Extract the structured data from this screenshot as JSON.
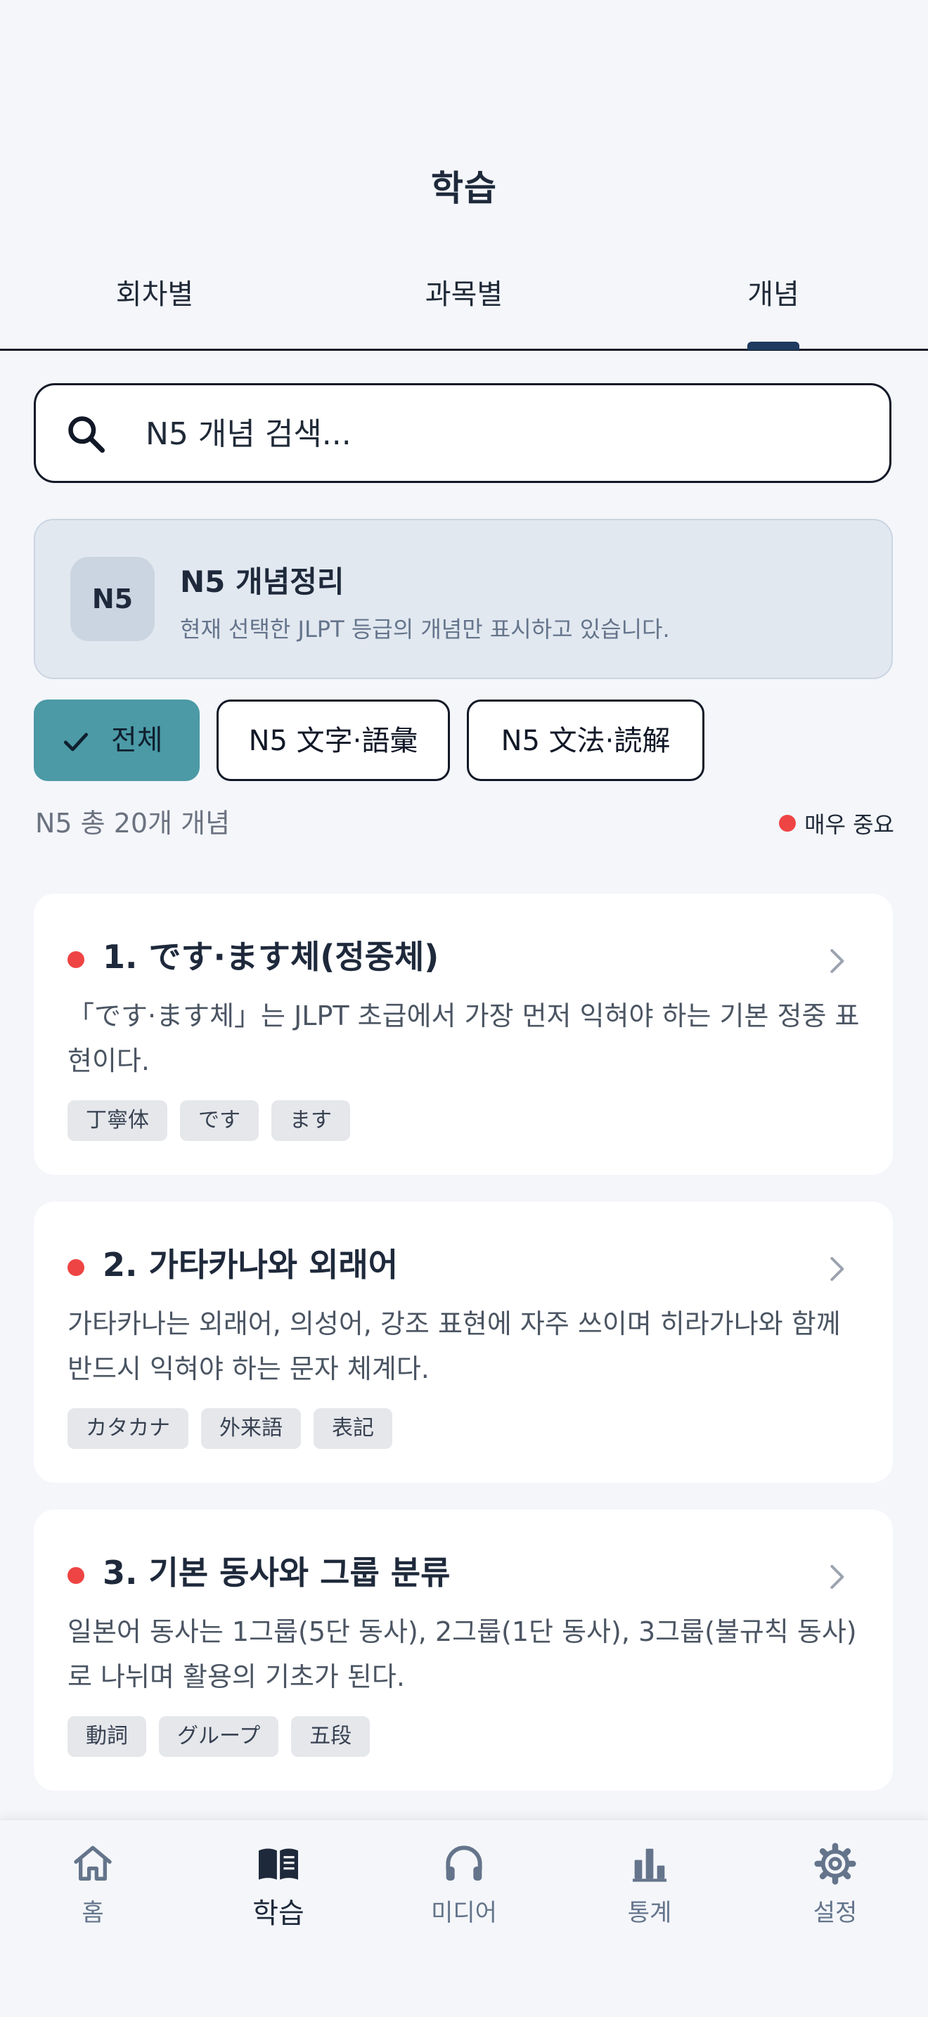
{
  "header": {
    "title": "학습",
    "tabs": [
      {
        "label": "회차별"
      },
      {
        "label": "과목별"
      },
      {
        "label": "개념"
      }
    ],
    "active_tab": "개념"
  },
  "search": {
    "placeholder": "N5 개념 검색..."
  },
  "info_card": {
    "badge": "N5",
    "title": "N5 개념정리",
    "description": "현재 선택한 JLPT 등급의 개념만 표시하고 있습니다."
  },
  "filters": {
    "chips": [
      {
        "label": "전체",
        "active": true
      },
      {
        "label": "N5 文字·語彙",
        "active": false
      },
      {
        "label": "N5 文法·読解",
        "active": false
      }
    ]
  },
  "summary": {
    "count_text": "N5 총 20개 개념",
    "legend_label": "매우 중요"
  },
  "concepts": [
    {
      "title": "1. です·ます체(정중체)",
      "description": "「です·ます체」는 JLPT 초급에서 가장 먼저 익혀야 하는 기본 정중 표현이다.",
      "tags": [
        "丁寧体",
        "です",
        "ます"
      ],
      "importance": "very-important"
    },
    {
      "title": "2. 가타카나와 외래어",
      "description": "가타카나는 외래어, 의성어, 강조 표현에 자주 쓰이며 히라가나와 함께 반드시 익혀야 하는 문자 체계다.",
      "tags": [
        "カタカナ",
        "外来語",
        "表記"
      ],
      "importance": "very-important"
    },
    {
      "title": "3. 기본 동사와 그룹 분류",
      "description": "일본어 동사는 1그룹(5단 동사), 2그룹(1단 동사), 3그룹(불규칙 동사)로 나뉘며 활용의 기초가 된다.",
      "tags": [
        "動詞",
        "グループ",
        "五段"
      ],
      "importance": "very-important"
    }
  ],
  "bottom_nav": {
    "items": [
      {
        "label": "홈",
        "icon": "home-icon"
      },
      {
        "label": "학습",
        "icon": "book-icon"
      },
      {
        "label": "미디어",
        "icon": "headphones-icon"
      },
      {
        "label": "통계",
        "icon": "bar-chart-icon"
      },
      {
        "label": "설정",
        "icon": "gear-icon"
      }
    ],
    "active": "학습"
  },
  "colors": {
    "accent": "#4b9aa6",
    "important": "#ef4444",
    "primary_text": "#1e293b",
    "background": "#f4f6fa"
  }
}
